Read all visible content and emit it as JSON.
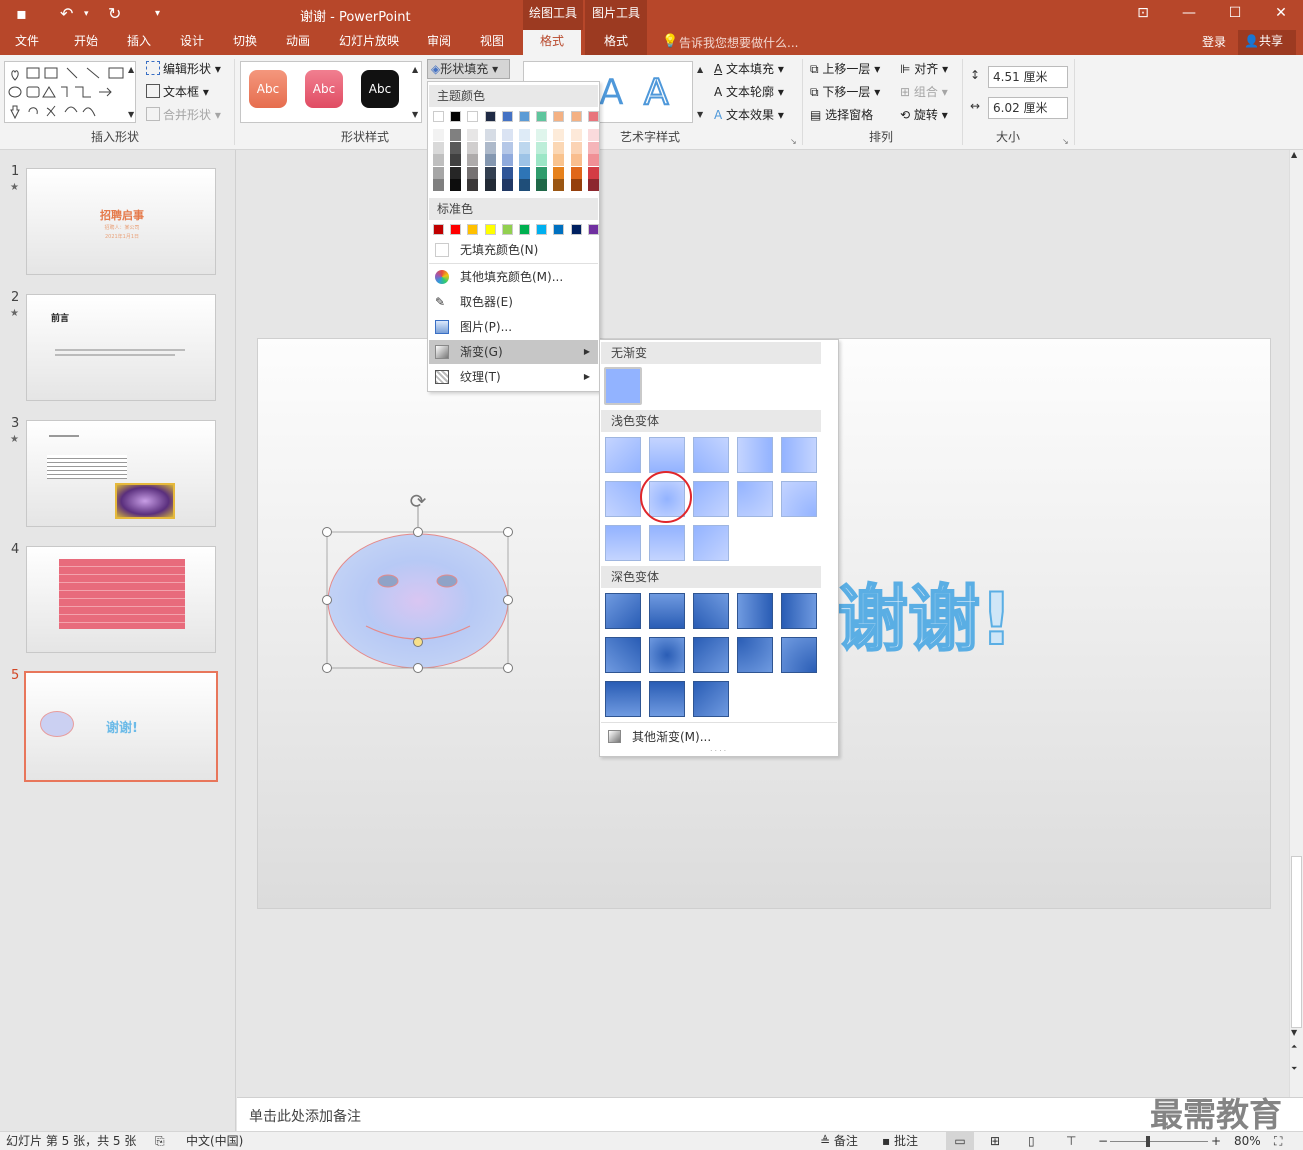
{
  "window": {
    "title": "谢谢 - PowerPoint",
    "context_tab_groups": [
      "绘图工具",
      "图片工具"
    ],
    "colors": {
      "accent": "#b7472a",
      "context": "#9c3a21"
    }
  },
  "tabs": [
    "文件",
    "开始",
    "插入",
    "设计",
    "切换",
    "动画",
    "幻灯片放映",
    "审阅",
    "视图",
    "格式",
    "格式"
  ],
  "search_hint": "告诉我您想要做什么...",
  "account": {
    "login": "登录",
    "share": "共享"
  },
  "ribbon": {
    "insert_shapes": {
      "label": "插入形状",
      "edit_shape": "编辑形状",
      "text_box": "文本框",
      "merge_shapes": "合并形状"
    },
    "shape_styles": {
      "label": "形状样式",
      "style_samples": [
        "Abc",
        "Abc",
        "Abc"
      ],
      "shape_fill": "形状填充"
    },
    "wordart": {
      "label": "艺术字样式",
      "text_fill": "文本填充",
      "text_outline": "文本轮廓",
      "text_effects": "文本效果"
    },
    "arrange": {
      "label": "排列",
      "bring_forward": "上移一层",
      "send_backward": "下移一层",
      "selection_pane": "选择窗格",
      "align": "对齐",
      "group": "组合",
      "rotate": "旋转"
    },
    "size": {
      "label": "大小",
      "height": "4.51 厘米",
      "width": "6.02 厘米"
    }
  },
  "fill_menu": {
    "theme_colors_header": "主题颜色",
    "standard_colors_header": "标准色",
    "no_fill": "无填充颜色(N)",
    "more_colors": "其他填充颜色(M)...",
    "eyedropper": "取色器(E)",
    "picture": "图片(P)...",
    "gradient": "渐变(G)",
    "texture": "纹理(T)",
    "theme_top": [
      "#ffffff",
      "#000000",
      "#ffffff",
      "#1f2a44",
      "#4472c4",
      "#5b9bd5",
      "#5fc59d",
      "#f4b183",
      "#f4b183",
      "#e8747c"
    ],
    "theme_cols": [
      [
        "#f2f2f2",
        "#d9d9d9",
        "#bfbfbf",
        "#a6a6a6",
        "#7f7f7f"
      ],
      [
        "#808080",
        "#595959",
        "#404040",
        "#262626",
        "#0d0d0d"
      ],
      [
        "#e7e6e6",
        "#d0cece",
        "#aeabab",
        "#757171",
        "#3b3838"
      ],
      [
        "#d6dce5",
        "#adb9ca",
        "#8497b0",
        "#333f50",
        "#222a35"
      ],
      [
        "#dae3f3",
        "#b4c7e7",
        "#8faadc",
        "#2f5597",
        "#203864"
      ],
      [
        "#deebf7",
        "#bdd7ee",
        "#9dc3e6",
        "#2e75b6",
        "#1f4e79"
      ],
      [
        "#dff5ec",
        "#bdeed9",
        "#9ce6c6",
        "#2f9c6c",
        "#1f6848"
      ],
      [
        "#fdebd9",
        "#fbd7b4",
        "#f9c38e",
        "#e6811c",
        "#9a5613"
      ],
      [
        "#fde9d9",
        "#fbd3b4",
        "#f9bd8e",
        "#e0661a",
        "#953f0c"
      ],
      [
        "#fadadc",
        "#f5b5b9",
        "#f09096",
        "#d33c45",
        "#8c272e"
      ]
    ],
    "standard": [
      "#c00000",
      "#ff0000",
      "#ffc000",
      "#ffff00",
      "#92d050",
      "#00b050",
      "#00b0f0",
      "#0070c0",
      "#002060",
      "#7030a0"
    ]
  },
  "gradient_menu": {
    "no_gradient": "无渐变",
    "light_variations": "浅色变体",
    "dark_variations": "深色变体",
    "more_gradients": "其他渐变(M)..."
  },
  "slides": {
    "numbers": [
      "1",
      "2",
      "3",
      "4",
      "5"
    ],
    "s1_title": "招聘启事",
    "s1_sub": "招聘人：某公司",
    "s1_date": "2021年1月1日",
    "s2_title": "前言",
    "s5_text": "谢谢!"
  },
  "notes_placeholder": "单击此处添加备注",
  "status": {
    "slide_info": "幻灯片 第 5 张，共 5 张",
    "language": "中文(中国)",
    "notes": "备注",
    "comments": "批注",
    "zoom": "80%"
  },
  "watermark": "最需教育"
}
